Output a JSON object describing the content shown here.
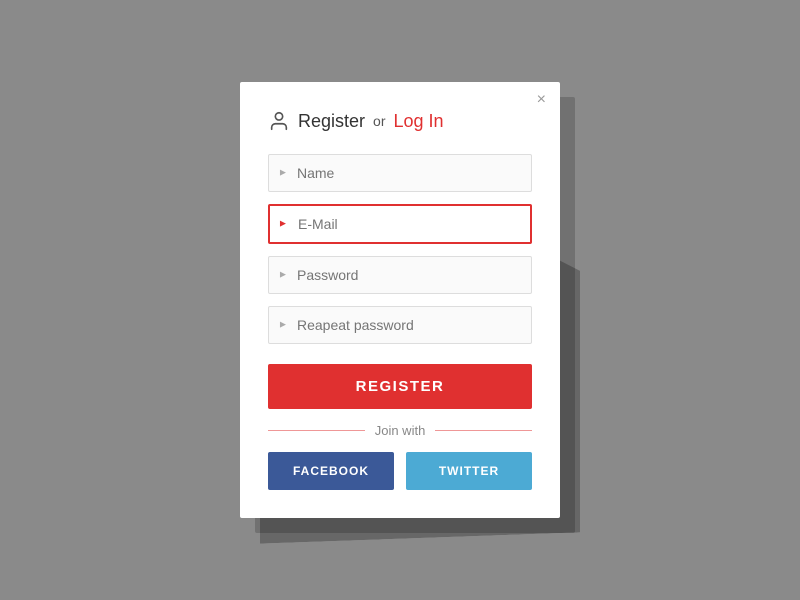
{
  "modal": {
    "close_label": "×",
    "title": {
      "register_text": "Register",
      "or_text": "or",
      "login_text": "Log In"
    },
    "fields": {
      "name_placeholder": "Name",
      "email_placeholder": "E-Mail",
      "password_placeholder": "Password",
      "repeat_password_placeholder": "Reapeat password"
    },
    "register_button": "REGISTER",
    "join_with_text": "Join with",
    "facebook_button": "FACEBOOK",
    "twitter_button": "TWITTER"
  }
}
